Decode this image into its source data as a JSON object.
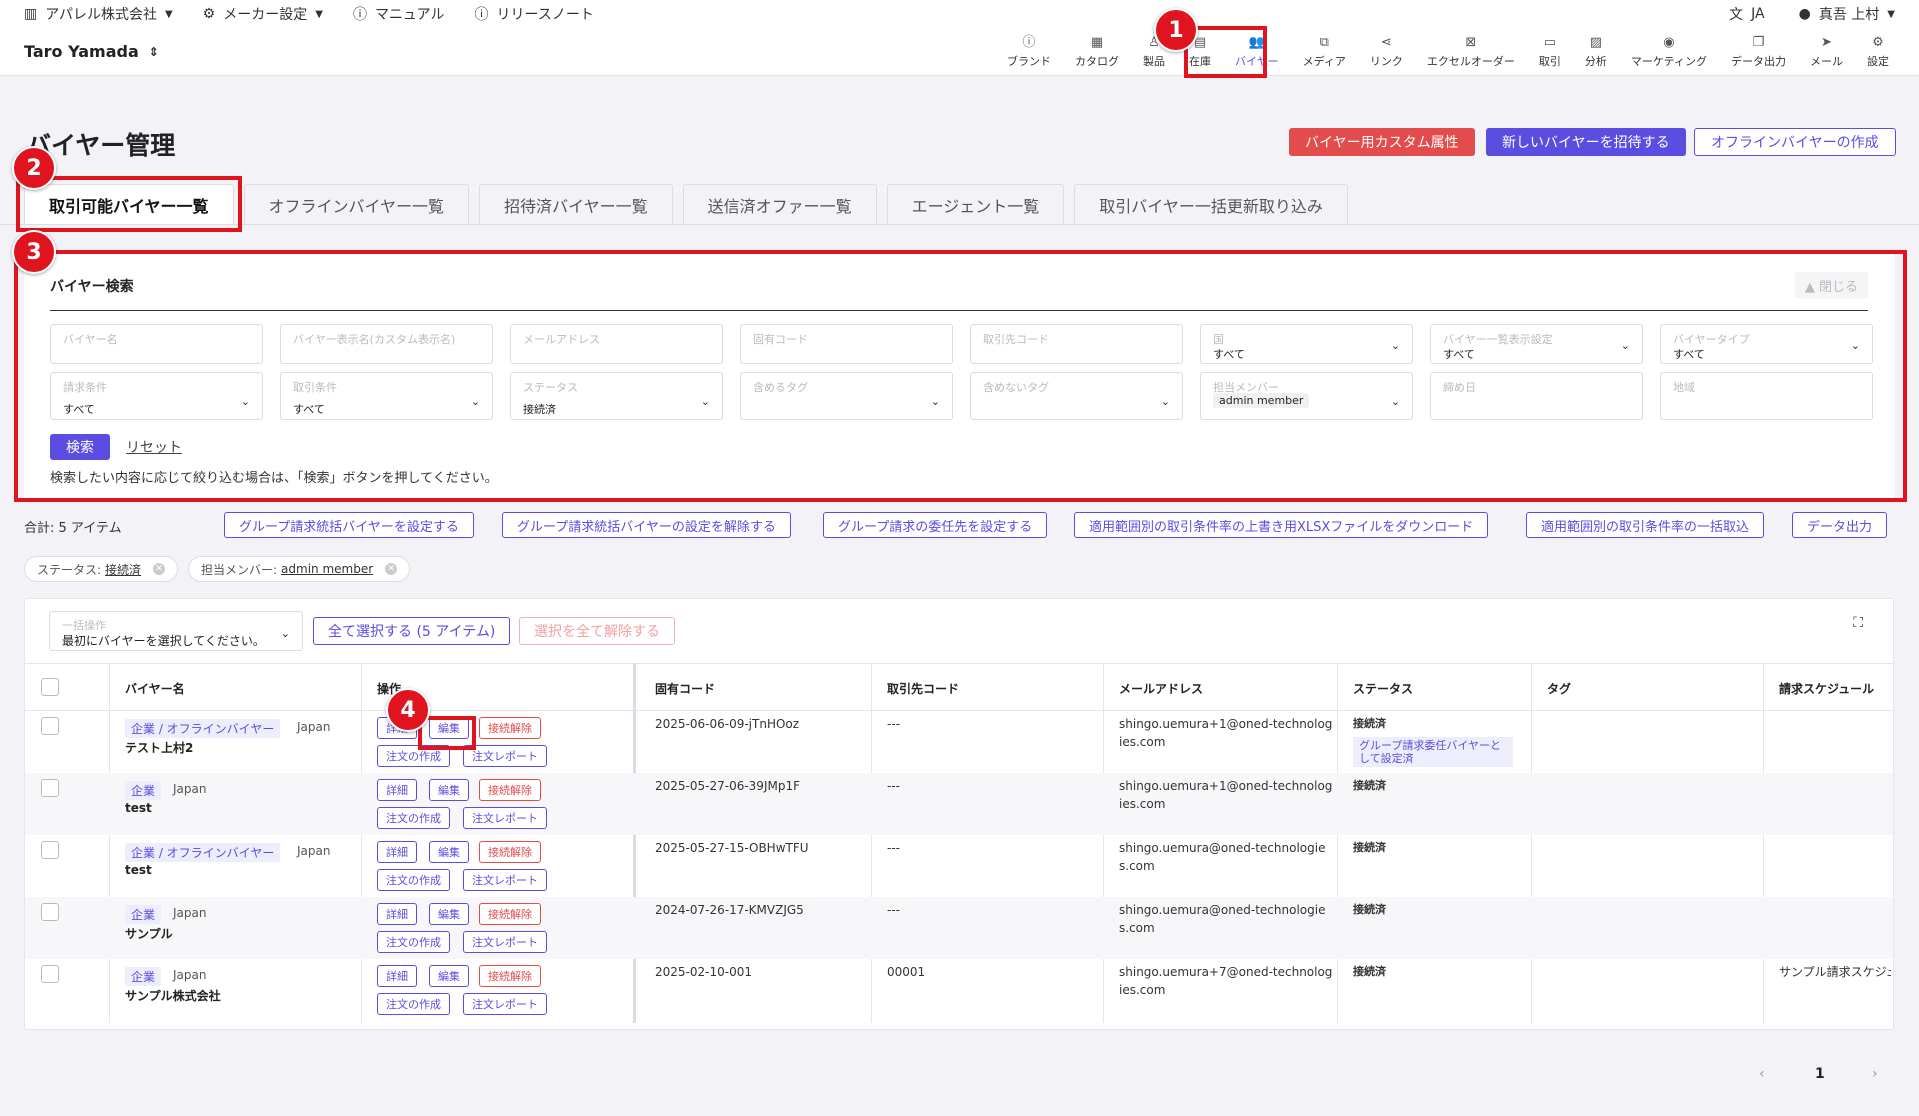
{
  "topbar": {
    "company": "アパレル株式会社",
    "maker_settings": "メーカー設定",
    "manual": "マニュアル",
    "release_notes": "リリースノート",
    "language": "JA",
    "user": "真吾 上村"
  },
  "header": {
    "user_name": "Taro Yamada",
    "nav": [
      "ブランド",
      "カタログ",
      "製品",
      "在庫",
      "バイヤー",
      "メディア",
      "リンク",
      "エクセルオーダー",
      "取引",
      "分析",
      "マーケティング",
      "データ出力",
      "メール",
      "設定"
    ]
  },
  "page": {
    "title": "バイヤー管理",
    "btn_custom_attr": "バイヤー用カスタム属性",
    "btn_invite": "新しいバイヤーを招待する",
    "btn_offline_create": "オフラインバイヤーの作成"
  },
  "tabs": [
    "取引可能バイヤー一覧",
    "オフラインバイヤー一覧",
    "招待済バイヤー一覧",
    "送信済オファー一覧",
    "エージェント一覧",
    "取引バイヤー一括更新取り込み"
  ],
  "search": {
    "title": "バイヤー検索",
    "close": "閉じる",
    "fields_row1": [
      {
        "label": "バイヤー名",
        "value": ""
      },
      {
        "label": "バイヤー表示名(カスタム表示名)",
        "value": ""
      },
      {
        "label": "メールアドレス",
        "value": ""
      },
      {
        "label": "固有コード",
        "value": ""
      },
      {
        "label": "取引先コード",
        "value": ""
      },
      {
        "label": "国",
        "value": "すべて"
      },
      {
        "label": "バイヤー一覧表示設定",
        "value": "すべて"
      },
      {
        "label": "バイヤータイプ",
        "value": "すべて"
      }
    ],
    "fields_row2": [
      {
        "label": "請求条件",
        "value": "すべて"
      },
      {
        "label": "取引条件",
        "value": "すべて"
      },
      {
        "label": "ステータス",
        "value": "接続済"
      },
      {
        "label": "含めるタグ",
        "value": ""
      },
      {
        "label": "含めないタグ",
        "value": ""
      },
      {
        "label": "担当メンバー",
        "value": "admin member"
      },
      {
        "label": "締め日",
        "value": ""
      },
      {
        "label": "地域",
        "value": ""
      }
    ],
    "btn_search": "検索",
    "btn_reset": "リセット",
    "hint": "検索したい内容に応じて絞り込む場合は、「検索」ボタンを押してください。"
  },
  "actions": {
    "total": "合計: 5 アイテム",
    "buttons": [
      "グループ請求統括バイヤーを設定する",
      "グループ請求統括バイヤーの設定を解除する",
      "グループ請求の委任先を設定する",
      "適用範囲別の取引条件率の上書き用XLSXファイルをダウンロード",
      "適用範囲別の取引条件率の一括取込",
      "データ出力"
    ]
  },
  "filters": [
    {
      "key": "ステータス:",
      "value": "接続済"
    },
    {
      "key": "担当メンバー:",
      "value": "admin member"
    }
  ],
  "table": {
    "bulk_label": "一括操作",
    "bulk_value": "最初にバイヤーを選択してください。",
    "select_all": "全て選択する (5 アイテム)",
    "deselect_all": "選択を全て解除する",
    "headers": [
      "バイヤー名",
      "操作",
      "固有コード",
      "取引先コード",
      "メールアドレス",
      "ステータス",
      "タグ",
      "請求スケジュール"
    ],
    "btn_labels": {
      "detail": "詳細",
      "edit": "編集",
      "disconnect": "接続解除",
      "create_order": "注文の作成",
      "order_report": "注文レポート"
    },
    "rows": [
      {
        "kind": "企業 / オフラインバイヤー",
        "country": "Japan",
        "name": "テスト上村2",
        "code": "2025-06-06-09-jTnHOoz",
        "partner": "---",
        "email1": "shingo.uemura+1@oned-technolog",
        "email2": "ies.com",
        "status": "接続済",
        "status_note": "グループ請求委任バイヤーとして設定済",
        "schedule": ""
      },
      {
        "kind": "企業",
        "country": "Japan",
        "name": "test",
        "code": "2025-05-27-06-39JMp1F",
        "partner": "---",
        "email1": "shingo.uemura+1@oned-technolog",
        "email2": "ies.com",
        "status": "接続済",
        "status_note": "",
        "schedule": ""
      },
      {
        "kind": "企業 / オフラインバイヤー",
        "country": "Japan",
        "name": "test",
        "code": "2025-05-27-15-OBHwTFU",
        "partner": "---",
        "email1": "shingo.uemura@oned-technologie",
        "email2": "s.com",
        "status": "接続済",
        "status_note": "",
        "schedule": ""
      },
      {
        "kind": "企業",
        "country": "Japan",
        "name": "サンプル",
        "code": "2024-07-26-17-KMVZJG5",
        "partner": "---",
        "email1": "shingo.uemura@oned-technologie",
        "email2": "s.com",
        "status": "接続済",
        "status_note": "",
        "schedule": ""
      },
      {
        "kind": "企業",
        "country": "Japan",
        "name": "サンプル株式会社",
        "code": "2025-02-10-001",
        "partner": "00001",
        "email1": "shingo.uemura+7@oned-technolog",
        "email2": "ies.com",
        "status": "接続済",
        "status_note": "",
        "schedule": "サンプル請求スケジュ"
      }
    ]
  },
  "pagination": {
    "prev": "‹",
    "current": "1",
    "next": "›"
  },
  "annotations": [
    "1",
    "2",
    "3",
    "4"
  ],
  "icons": {
    "accent": "#5b4de0",
    "danger": "#e24c4c",
    "annotation": "#e0141e"
  }
}
